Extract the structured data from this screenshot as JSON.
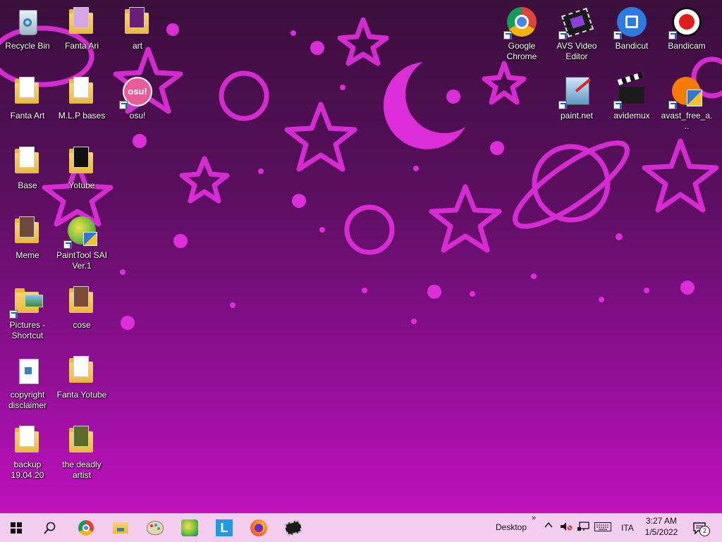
{
  "desktop": {
    "icons": [
      {
        "label": "Recycle Bin"
      },
      {
        "label": "Fanta Ari"
      },
      {
        "label": "art"
      },
      {
        "label": "Fanta Art"
      },
      {
        "label": "M.L.P bases"
      },
      {
        "label": "osu!"
      },
      {
        "label": "Base"
      },
      {
        "label": "Yotube"
      },
      {
        "label": "Meme"
      },
      {
        "label": "PaintTool SAI Ver.1"
      },
      {
        "label": "Pictures - Shortcut"
      },
      {
        "label": "cose"
      },
      {
        "label": "copyright disclaimer"
      },
      {
        "label": "Fanta Yotube"
      },
      {
        "label": "backup 19.04.20"
      },
      {
        "label": "the deadly artist"
      },
      {
        "label": "Google Chrome"
      },
      {
        "label": "AVS Video Editor"
      },
      {
        "label": "Bandicut"
      },
      {
        "label": "Bandicam"
      },
      {
        "label": "paint.net"
      },
      {
        "label": "avidemux"
      },
      {
        "label": "avast_free_a..."
      }
    ],
    "osu_badge": "osu!"
  },
  "taskbar": {
    "desktop_label": "Desktop",
    "chevron": "»",
    "language": "ITA",
    "time": "3:27 AM",
    "date": "1/5/2022",
    "notification_count": "2",
    "app_letter": "L"
  },
  "colors": {
    "taskbar_bg": "#f3cdf0",
    "wallpaper_star": "#e92fe6",
    "wallpaper_top": "#3a0f3c",
    "wallpaper_bottom": "#c812c6"
  }
}
